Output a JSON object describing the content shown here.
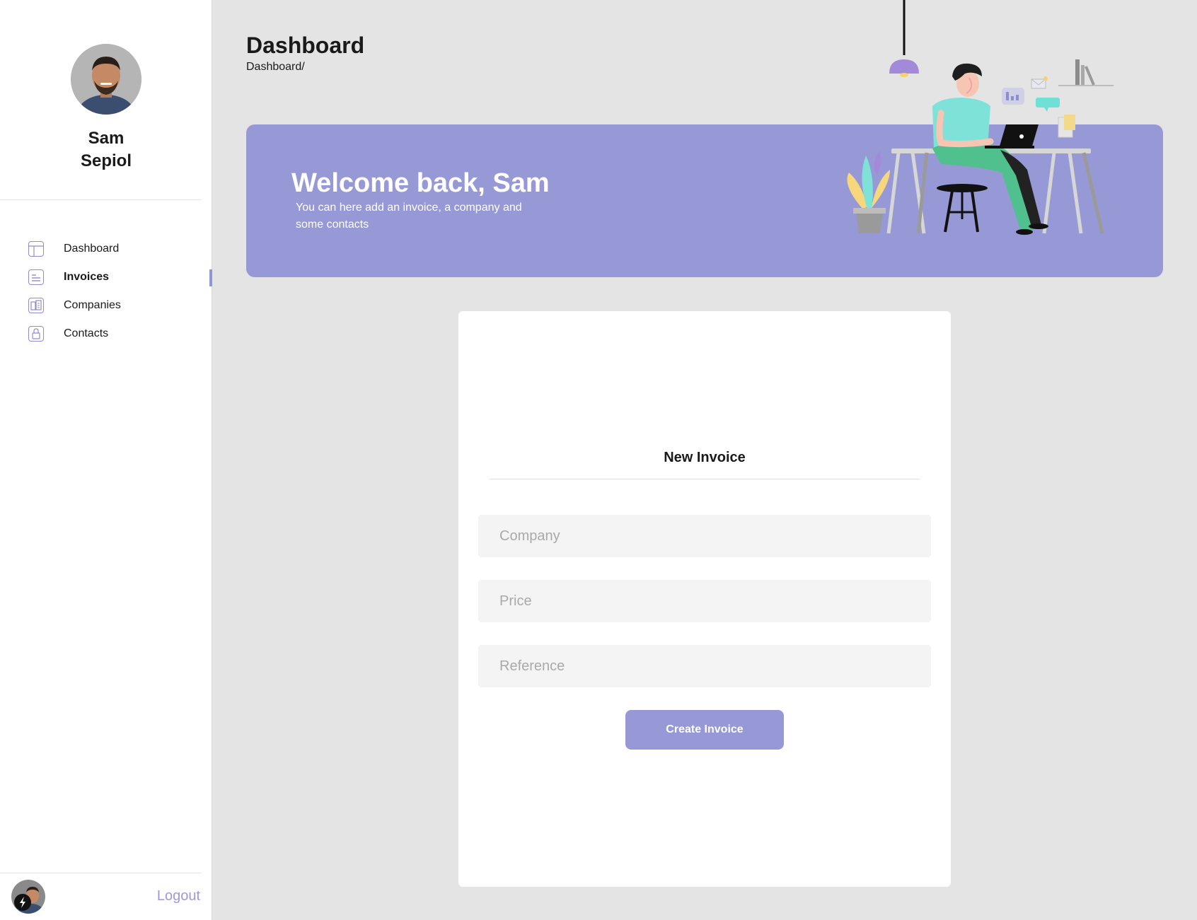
{
  "user": {
    "name": "Sam Sepiol"
  },
  "sidebar": {
    "items": [
      {
        "label": "Dashboard",
        "icon": "layout-icon"
      },
      {
        "label": "Invoices",
        "icon": "invoice-icon",
        "active": true
      },
      {
        "label": "Companies",
        "icon": "building-icon"
      },
      {
        "label": "Contacts",
        "icon": "lock-icon"
      }
    ],
    "logout_label": "Logout"
  },
  "header": {
    "title": "Dashboard",
    "breadcrumb": "Dashboard/"
  },
  "hero": {
    "title": "Welcome back, Sam",
    "subtitle": "You can here add an invoice, a company and some contacts"
  },
  "form": {
    "title": "New Invoice",
    "company_placeholder": "Company",
    "price_placeholder": "Price",
    "reference_placeholder": "Reference",
    "submit_label": "Create Invoice"
  },
  "colors": {
    "accent": "#9799d6",
    "sidebar_bg": "#ffffff",
    "page_bg": "#e4e4e4"
  }
}
